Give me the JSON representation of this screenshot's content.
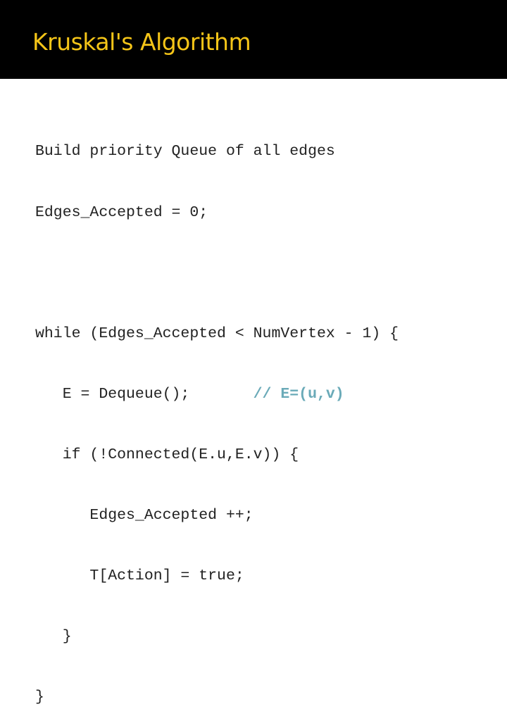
{
  "slide": {
    "title": "Kruskal's Algorithm",
    "title_color": "#f5c518",
    "comment_color": "#6aaab8"
  },
  "code": {
    "lines": [
      {
        "text": "Build priority Queue of all edges",
        "comment": ""
      },
      {
        "text": "Edges_Accepted = 0;",
        "comment": ""
      },
      {
        "text": "",
        "comment": ""
      },
      {
        "text": "while (Edges_Accepted < NumVertex - 1) {",
        "comment": ""
      },
      {
        "text": "   E = Dequeue();       ",
        "comment": "// E=(u,v)"
      },
      {
        "text": "   if (!Connected(E.u,E.v)) {",
        "comment": ""
      },
      {
        "text": "      Edges_Accepted ++;",
        "comment": ""
      },
      {
        "text": "      T[Action] = true;",
        "comment": ""
      },
      {
        "text": "   }",
        "comment": ""
      },
      {
        "text": "}",
        "comment": ""
      }
    ]
  }
}
